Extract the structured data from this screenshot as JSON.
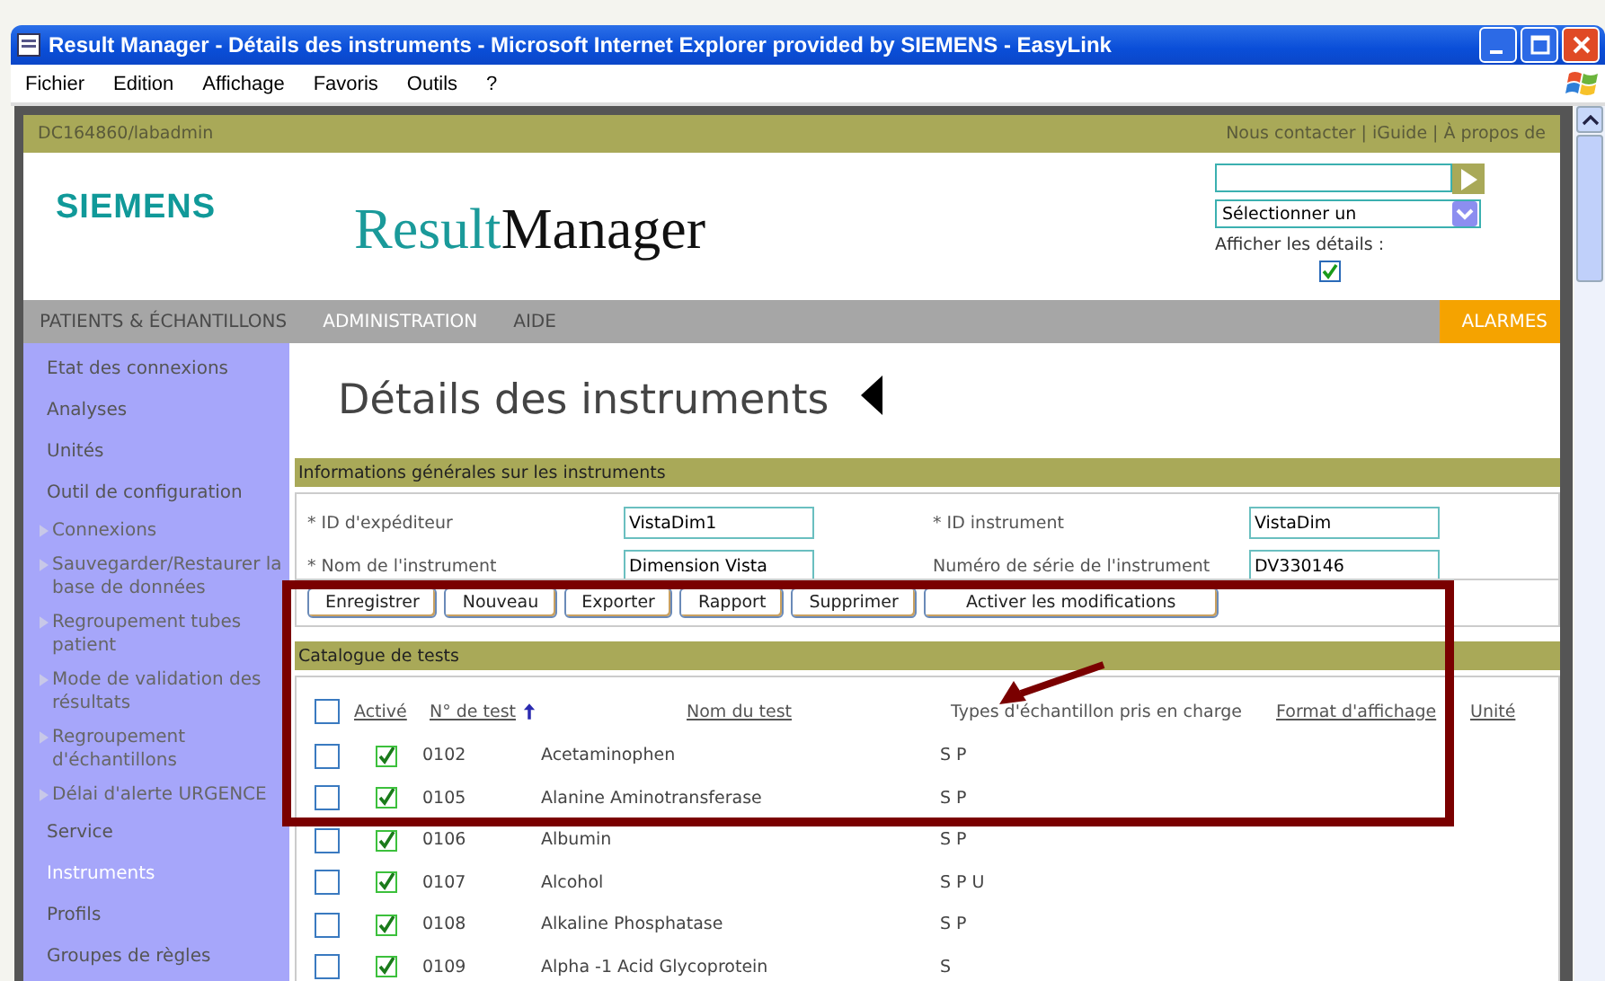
{
  "window": {
    "title": "Result Manager - Détails des instruments - Microsoft Internet Explorer provided by SIEMENS - EasyLink"
  },
  "menu_bar": [
    "Fichier",
    "Edition",
    "Affichage",
    "Favoris",
    "Outils",
    "?"
  ],
  "top_bar": {
    "user": "DC164860/labadmin",
    "links": [
      "Nous contacter",
      "iGuide",
      "À propos de"
    ],
    "separator": "|"
  },
  "header": {
    "logo": "SIEMENS",
    "product_first": "Result",
    "product_second": "Manager",
    "select": {
      "value": "Sélectionner un"
    },
    "details_label": "Afficher les détails :",
    "details_checked": true
  },
  "nav": {
    "items": [
      {
        "label": "PATIENTS & ÉCHANTILLONS",
        "selected": false
      },
      {
        "label": "ADMINISTRATION",
        "selected": true
      },
      {
        "label": "AIDE",
        "selected": false
      }
    ],
    "alarm": "ALARMES"
  },
  "sidebar": {
    "items": [
      {
        "label": "Etat des connexions",
        "selected": false
      },
      {
        "label": "Analyses",
        "selected": false
      },
      {
        "label": "Unités",
        "selected": false
      },
      {
        "label": "Outil de configuration",
        "selected": false,
        "children": [
          {
            "label": "Connexions",
            "selected": false
          },
          {
            "label": "Sauvegarder/Restaurer la base de données",
            "selected": false
          },
          {
            "label": "Regroupement tubes patient",
            "selected": false
          },
          {
            "label": "Mode de validation des résultats",
            "selected": false
          },
          {
            "label": "Regroupement d'échantillons",
            "selected": false
          },
          {
            "label": "Délai d'alerte URGENCE",
            "selected": false
          }
        ]
      },
      {
        "label": "Service",
        "selected": false
      },
      {
        "label": "Instruments",
        "selected": true
      },
      {
        "label": "Profils",
        "selected": false
      },
      {
        "label": "Groupes de règles",
        "selected": false
      }
    ]
  },
  "page_title": "Détails des instruments",
  "general_section": {
    "title": "Informations générales sur les instruments",
    "fields": [
      {
        "label": "* ID d'expéditeur",
        "value": "VistaDim1"
      },
      {
        "label": "* ID instrument",
        "value": "VistaDim"
      },
      {
        "label": "* Nom de l'instrument",
        "value": "Dimension Vista"
      },
      {
        "label": "Numéro de série de l'instrument",
        "value": "DV330146"
      }
    ]
  },
  "buttons": [
    "Enregistrer",
    "Nouveau",
    "Exporter",
    "Rapport",
    "Supprimer",
    "Activer les modifications"
  ],
  "catalog": {
    "title": "Catalogue de tests",
    "select_all_checked": false,
    "columns": [
      {
        "label": "Activé",
        "kind": "link"
      },
      {
        "label": "N° de test",
        "kind": "link",
        "sorted": true
      },
      {
        "label": "Nom du test",
        "kind": "link"
      },
      {
        "label": "Types d'échantillon pris en charge",
        "kind": "plain"
      },
      {
        "label": "Format d'affichage",
        "kind": "link"
      },
      {
        "label": "Unité",
        "kind": "link"
      }
    ],
    "rows": [
      {
        "checked": false,
        "active": true,
        "number": "0102",
        "name": "Acetaminophen",
        "types": "S P"
      },
      {
        "checked": false,
        "active": true,
        "number": "0105",
        "name": "Alanine Aminotransferase",
        "types": "S P"
      },
      {
        "checked": false,
        "active": true,
        "number": "0106",
        "name": "Albumin",
        "types": "S P"
      },
      {
        "checked": false,
        "active": true,
        "number": "0107",
        "name": "Alcohol",
        "types": "S P U"
      },
      {
        "checked": false,
        "active": true,
        "number": "0108",
        "name": "Alkaline Phosphatase",
        "types": "S P"
      },
      {
        "checked": false,
        "active": true,
        "number": "0109",
        "name": "Alpha -1 Acid Glycoprotein",
        "types": "S"
      }
    ]
  }
}
